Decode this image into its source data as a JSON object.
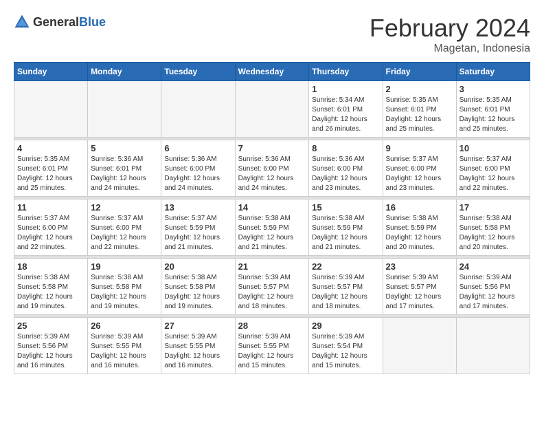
{
  "header": {
    "logo_general": "General",
    "logo_blue": "Blue",
    "month_title": "February 2024",
    "location": "Magetan, Indonesia"
  },
  "weekdays": [
    "Sunday",
    "Monday",
    "Tuesday",
    "Wednesday",
    "Thursday",
    "Friday",
    "Saturday"
  ],
  "weeks": [
    [
      {
        "day": "",
        "info": ""
      },
      {
        "day": "",
        "info": ""
      },
      {
        "day": "",
        "info": ""
      },
      {
        "day": "",
        "info": ""
      },
      {
        "day": "1",
        "info": "Sunrise: 5:34 AM\nSunset: 6:01 PM\nDaylight: 12 hours\nand 26 minutes."
      },
      {
        "day": "2",
        "info": "Sunrise: 5:35 AM\nSunset: 6:01 PM\nDaylight: 12 hours\nand 25 minutes."
      },
      {
        "day": "3",
        "info": "Sunrise: 5:35 AM\nSunset: 6:01 PM\nDaylight: 12 hours\nand 25 minutes."
      }
    ],
    [
      {
        "day": "4",
        "info": "Sunrise: 5:35 AM\nSunset: 6:01 PM\nDaylight: 12 hours\nand 25 minutes."
      },
      {
        "day": "5",
        "info": "Sunrise: 5:36 AM\nSunset: 6:01 PM\nDaylight: 12 hours\nand 24 minutes."
      },
      {
        "day": "6",
        "info": "Sunrise: 5:36 AM\nSunset: 6:00 PM\nDaylight: 12 hours\nand 24 minutes."
      },
      {
        "day": "7",
        "info": "Sunrise: 5:36 AM\nSunset: 6:00 PM\nDaylight: 12 hours\nand 24 minutes."
      },
      {
        "day": "8",
        "info": "Sunrise: 5:36 AM\nSunset: 6:00 PM\nDaylight: 12 hours\nand 23 minutes."
      },
      {
        "day": "9",
        "info": "Sunrise: 5:37 AM\nSunset: 6:00 PM\nDaylight: 12 hours\nand 23 minutes."
      },
      {
        "day": "10",
        "info": "Sunrise: 5:37 AM\nSunset: 6:00 PM\nDaylight: 12 hours\nand 22 minutes."
      }
    ],
    [
      {
        "day": "11",
        "info": "Sunrise: 5:37 AM\nSunset: 6:00 PM\nDaylight: 12 hours\nand 22 minutes."
      },
      {
        "day": "12",
        "info": "Sunrise: 5:37 AM\nSunset: 6:00 PM\nDaylight: 12 hours\nand 22 minutes."
      },
      {
        "day": "13",
        "info": "Sunrise: 5:37 AM\nSunset: 5:59 PM\nDaylight: 12 hours\nand 21 minutes."
      },
      {
        "day": "14",
        "info": "Sunrise: 5:38 AM\nSunset: 5:59 PM\nDaylight: 12 hours\nand 21 minutes."
      },
      {
        "day": "15",
        "info": "Sunrise: 5:38 AM\nSunset: 5:59 PM\nDaylight: 12 hours\nand 21 minutes."
      },
      {
        "day": "16",
        "info": "Sunrise: 5:38 AM\nSunset: 5:59 PM\nDaylight: 12 hours\nand 20 minutes."
      },
      {
        "day": "17",
        "info": "Sunrise: 5:38 AM\nSunset: 5:58 PM\nDaylight: 12 hours\nand 20 minutes."
      }
    ],
    [
      {
        "day": "18",
        "info": "Sunrise: 5:38 AM\nSunset: 5:58 PM\nDaylight: 12 hours\nand 19 minutes."
      },
      {
        "day": "19",
        "info": "Sunrise: 5:38 AM\nSunset: 5:58 PM\nDaylight: 12 hours\nand 19 minutes."
      },
      {
        "day": "20",
        "info": "Sunrise: 5:38 AM\nSunset: 5:58 PM\nDaylight: 12 hours\nand 19 minutes."
      },
      {
        "day": "21",
        "info": "Sunrise: 5:39 AM\nSunset: 5:57 PM\nDaylight: 12 hours\nand 18 minutes."
      },
      {
        "day": "22",
        "info": "Sunrise: 5:39 AM\nSunset: 5:57 PM\nDaylight: 12 hours\nand 18 minutes."
      },
      {
        "day": "23",
        "info": "Sunrise: 5:39 AM\nSunset: 5:57 PM\nDaylight: 12 hours\nand 17 minutes."
      },
      {
        "day": "24",
        "info": "Sunrise: 5:39 AM\nSunset: 5:56 PM\nDaylight: 12 hours\nand 17 minutes."
      }
    ],
    [
      {
        "day": "25",
        "info": "Sunrise: 5:39 AM\nSunset: 5:56 PM\nDaylight: 12 hours\nand 16 minutes."
      },
      {
        "day": "26",
        "info": "Sunrise: 5:39 AM\nSunset: 5:55 PM\nDaylight: 12 hours\nand 16 minutes."
      },
      {
        "day": "27",
        "info": "Sunrise: 5:39 AM\nSunset: 5:55 PM\nDaylight: 12 hours\nand 16 minutes."
      },
      {
        "day": "28",
        "info": "Sunrise: 5:39 AM\nSunset: 5:55 PM\nDaylight: 12 hours\nand 15 minutes."
      },
      {
        "day": "29",
        "info": "Sunrise: 5:39 AM\nSunset: 5:54 PM\nDaylight: 12 hours\nand 15 minutes."
      },
      {
        "day": "",
        "info": ""
      },
      {
        "day": "",
        "info": ""
      }
    ]
  ]
}
